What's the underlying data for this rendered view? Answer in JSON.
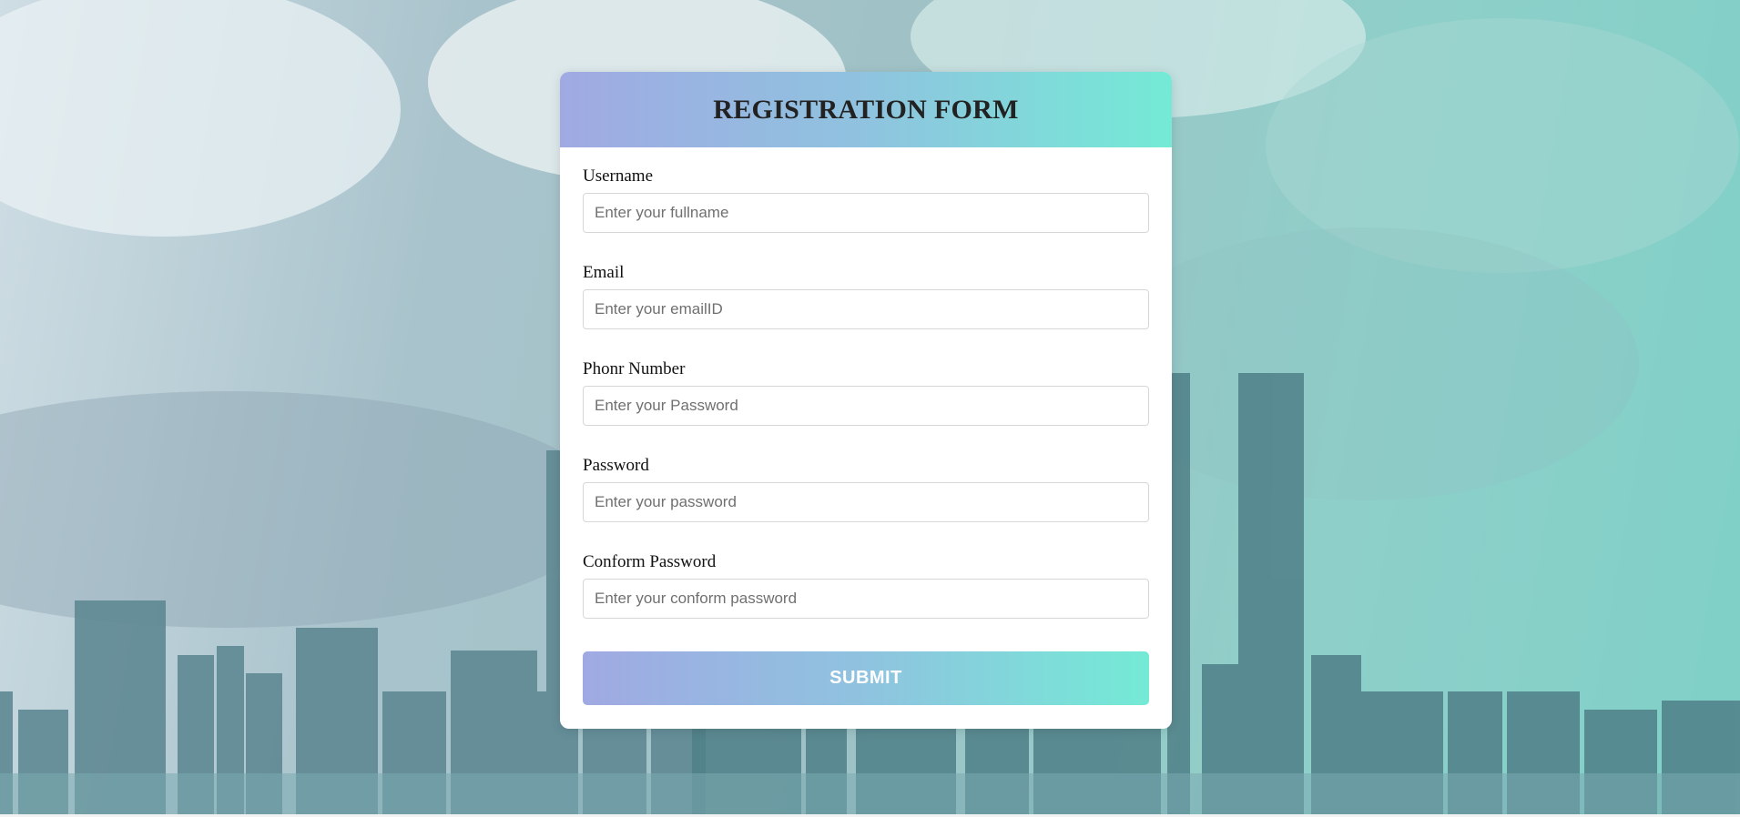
{
  "form": {
    "title": "REGISTRATION FORM",
    "fields": [
      {
        "label": "Username",
        "placeholder": "Enter your fullname"
      },
      {
        "label": "Email",
        "placeholder": "Enter your emailID"
      },
      {
        "label": "Phonr Number",
        "placeholder": "Enter your Password"
      },
      {
        "label": "Password",
        "placeholder": "Enter your password"
      },
      {
        "label": "Conform Password",
        "placeholder": "Enter your conform password"
      }
    ],
    "submit_label": "SUBMIT"
  },
  "colors": {
    "header_gradient_start": "#a0a9e3",
    "header_gradient_end": "#74ead6",
    "card_background": "#ffffff"
  }
}
